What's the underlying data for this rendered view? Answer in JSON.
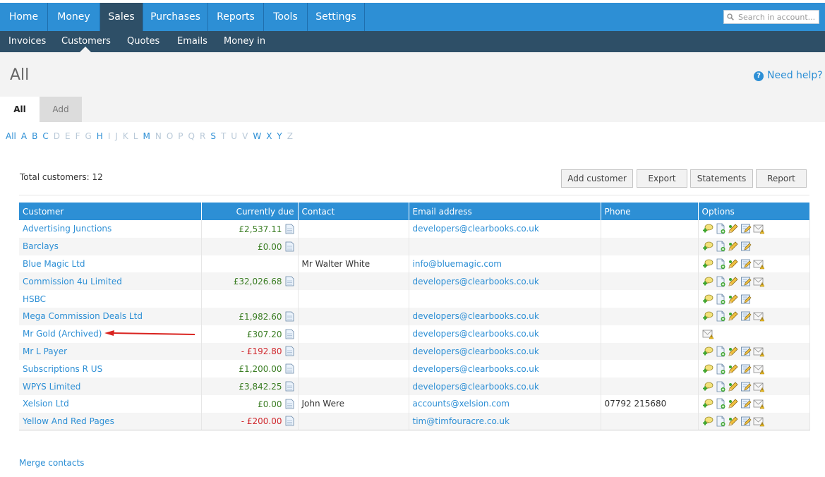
{
  "topnav": {
    "tabs": [
      {
        "label": "Home"
      },
      {
        "label": "Money"
      },
      {
        "label": "Sales"
      },
      {
        "label": "Purchases"
      },
      {
        "label": "Reports"
      },
      {
        "label": "Tools"
      },
      {
        "label": "Settings"
      }
    ],
    "active": "Sales",
    "search_placeholder": "Search in account..."
  },
  "subnav": {
    "tabs": [
      {
        "label": "Invoices"
      },
      {
        "label": "Customers"
      },
      {
        "label": "Quotes"
      },
      {
        "label": "Emails"
      },
      {
        "label": "Money in"
      }
    ],
    "active": "Customers"
  },
  "page": {
    "title": "All",
    "help_label": "Need help?",
    "tab_all": "All",
    "tab_add": "Add"
  },
  "alphabet": {
    "letters": [
      "All",
      "A",
      "B",
      "C",
      "D",
      "E",
      "F",
      "G",
      "H",
      "I",
      "J",
      "K",
      "L",
      "M",
      "N",
      "O",
      "P",
      "Q",
      "R",
      "S",
      "T",
      "U",
      "V",
      "W",
      "X",
      "Y",
      "Z"
    ],
    "enabled": [
      "All",
      "A",
      "B",
      "C",
      "H",
      "M",
      "S",
      "W",
      "X",
      "Y"
    ]
  },
  "summary": {
    "total_label": "Total customers: 12"
  },
  "actions": {
    "add_customer": "Add customer",
    "export": "Export",
    "statements": "Statements",
    "report": "Report"
  },
  "table": {
    "headers": {
      "customer": "Customer",
      "due": "Currently due",
      "contact": "Contact",
      "email": "Email address",
      "phone": "Phone",
      "options": "Options"
    },
    "rows": [
      {
        "customer": "Advertising Junctions",
        "due": "£2,537.11",
        "due_class": "pos",
        "doc": true,
        "contact": "",
        "email": "developers@clearbooks.co.uk",
        "phone": "",
        "options": [
          "add-note",
          "new-doc",
          "edit",
          "edit-form",
          "email-warning"
        ]
      },
      {
        "customer": "Barclays",
        "due": "£0.00",
        "due_class": "pos",
        "doc": true,
        "contact": "",
        "email": "",
        "phone": "",
        "options": [
          "add-note",
          "new-doc",
          "edit",
          "edit-form"
        ]
      },
      {
        "customer": "Blue Magic Ltd",
        "due": "",
        "due_class": "pos",
        "doc": false,
        "contact": "Mr Walter White",
        "email": "info@bluemagic.com",
        "phone": "",
        "options": [
          "add-note",
          "new-doc",
          "edit",
          "edit-form",
          "email-warning"
        ]
      },
      {
        "customer": "Commission 4u Limited",
        "due": "£32,026.68",
        "due_class": "pos",
        "doc": true,
        "contact": "",
        "email": "developers@clearbooks.co.uk",
        "phone": "",
        "options": [
          "add-note",
          "new-doc",
          "edit",
          "edit-form",
          "email-warning"
        ]
      },
      {
        "customer": "HSBC",
        "due": "",
        "due_class": "pos",
        "doc": false,
        "contact": "",
        "email": "",
        "phone": "",
        "options": [
          "add-note",
          "new-doc",
          "edit",
          "edit-form"
        ]
      },
      {
        "customer": "Mega Commission Deals Ltd",
        "due": "£1,982.60",
        "due_class": "pos",
        "doc": true,
        "contact": "",
        "email": "developers@clearbooks.co.uk",
        "phone": "",
        "options": [
          "add-note",
          "new-doc",
          "edit",
          "edit-form",
          "email-warning"
        ]
      },
      {
        "customer": "Mr Gold (Archived)",
        "due": "£307.20",
        "due_class": "pos",
        "doc": true,
        "contact": "",
        "email": "developers@clearbooks.co.uk",
        "phone": "",
        "options": [
          "email-warning"
        ]
      },
      {
        "customer": "Mr L Payer",
        "due": "- £192.80",
        "due_class": "neg",
        "doc": true,
        "contact": "",
        "email": "developers@clearbooks.co.uk",
        "phone": "",
        "options": [
          "add-note",
          "new-doc",
          "edit",
          "edit-form",
          "email-warning"
        ]
      },
      {
        "customer": "Subscriptions R US",
        "due": "£1,200.00",
        "due_class": "pos",
        "doc": true,
        "contact": "",
        "email": "developers@clearbooks.co.uk",
        "phone": "",
        "options": [
          "add-note",
          "new-doc",
          "edit",
          "edit-form",
          "email-warning"
        ]
      },
      {
        "customer": "WPYS Limited",
        "due": "£3,842.25",
        "due_class": "pos",
        "doc": true,
        "contact": "",
        "email": "developers@clearbooks.co.uk",
        "phone": "",
        "options": [
          "add-note",
          "new-doc",
          "edit",
          "edit-form",
          "email-warning"
        ]
      },
      {
        "customer": "Xelsion Ltd",
        "due": "£0.00",
        "due_class": "pos",
        "doc": true,
        "contact": "John Were",
        "email": "accounts@xelsion.com",
        "phone": "07792 215680",
        "options": [
          "add-note",
          "new-doc",
          "edit",
          "edit-form",
          "email-warning"
        ]
      },
      {
        "customer": "Yellow And Red Pages",
        "due": "- £200.00",
        "due_class": "neg",
        "doc": true,
        "contact": "",
        "email": "tim@timfouracre.co.uk",
        "phone": "",
        "options": [
          "add-note",
          "new-doc",
          "edit",
          "edit-form",
          "email-warning"
        ]
      }
    ]
  },
  "footer": {
    "merge_label": "Merge contacts"
  },
  "colors": {
    "primary": "#2d8fd5",
    "nav_dark": "#2e4f67",
    "positive": "#3a7d23",
    "negative": "#d0282d",
    "annotation_arrow": "#d9231f"
  }
}
